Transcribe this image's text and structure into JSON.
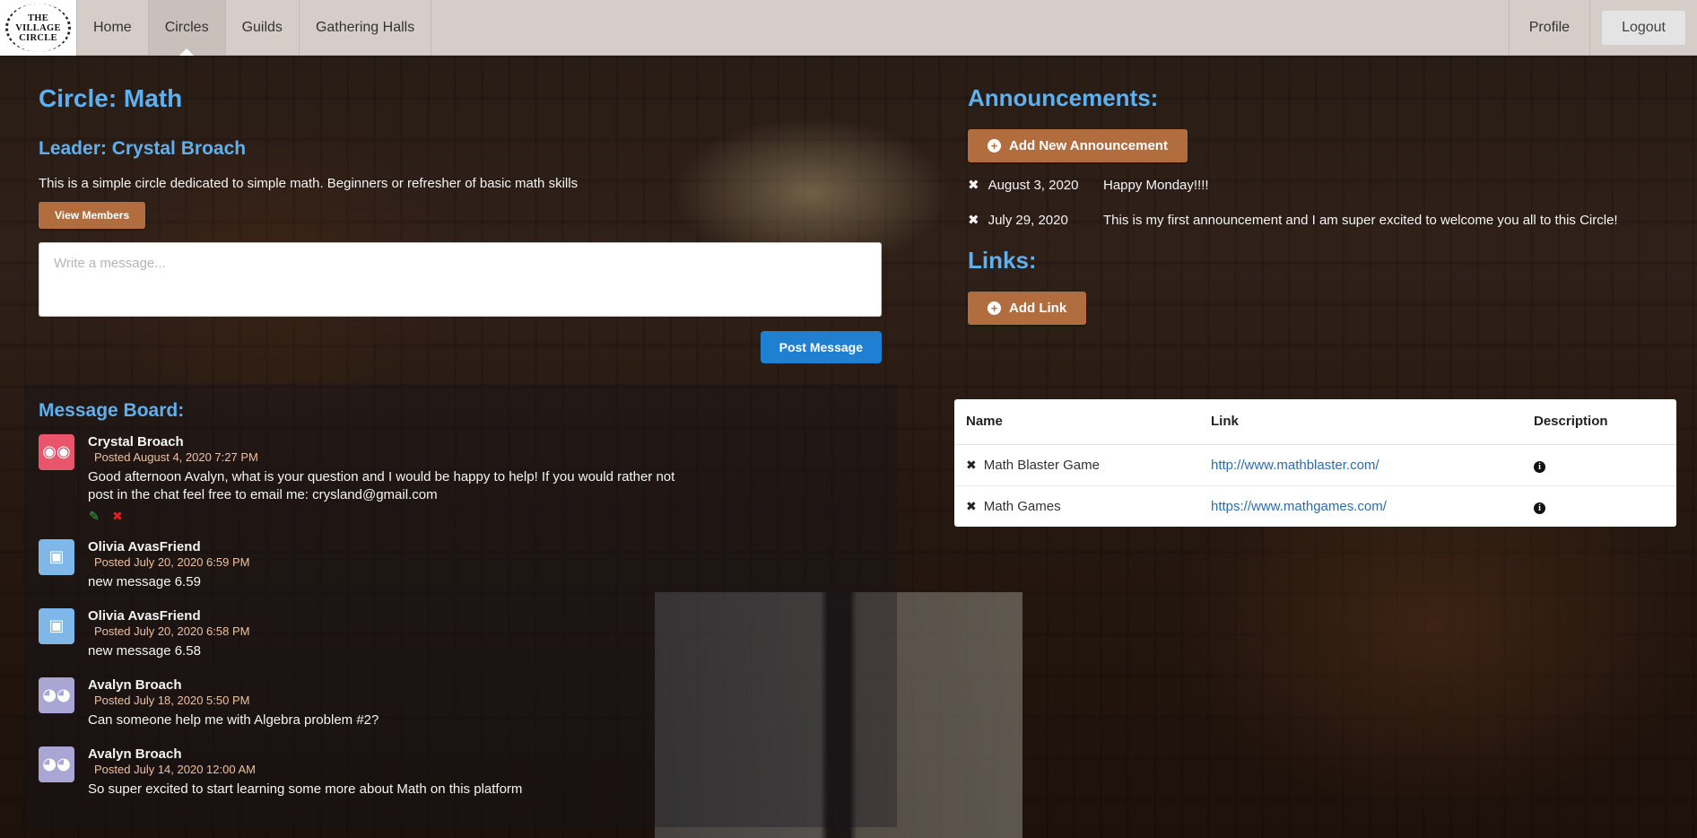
{
  "nav": {
    "logo_text": [
      "THE",
      "VILLAGE",
      "CIRCLE"
    ],
    "items": [
      {
        "label": "Home"
      },
      {
        "label": "Circles"
      },
      {
        "label": "Guilds"
      },
      {
        "label": "Gathering Halls"
      }
    ],
    "profile_label": "Profile",
    "logout_label": "Logout"
  },
  "circle": {
    "title": "Circle: Math",
    "leader": "Leader: Crystal Broach",
    "description": "This is a simple circle dedicated to simple math. Beginners or refresher of basic math skills",
    "view_members_label": "View Members",
    "message_placeholder": "Write a message...",
    "post_label": "Post Message"
  },
  "board": {
    "title": "Message Board:",
    "messages": [
      {
        "author": "Crystal Broach",
        "date": "Posted August 4, 2020 7:27 PM",
        "text": "Good afternoon Avalyn, what is your question and I would be happy to help! If you would rather not post in the chat feel free to email me: crysland@gmail.com",
        "avatar_color": "#e8556d"
      },
      {
        "author": "Olivia AvasFriend",
        "date": "Posted July 20, 2020 6:59 PM",
        "text": "new message 6.59",
        "avatar_color": "#7fb8e8"
      },
      {
        "author": "Olivia AvasFriend",
        "date": "Posted July 20, 2020 6:58 PM",
        "text": "new message 6.58",
        "avatar_color": "#7fb8e8"
      },
      {
        "author": "Avalyn Broach",
        "date": "Posted July 18, 2020 5:50 PM",
        "text": "Can someone help me with Algebra problem #2?",
        "avatar_color": "#a9a6d6"
      },
      {
        "author": "Avalyn Broach",
        "date": "Posted July 14, 2020 12:00 AM",
        "text": "So super excited to start learning some more about Math on this platform",
        "avatar_color": "#a9a6d6"
      }
    ]
  },
  "announcements": {
    "title": "Announcements:",
    "add_label": "Add New Announcement",
    "items": [
      {
        "date": "August 3, 2020",
        "text": "Happy Monday!!!!"
      },
      {
        "date": "July 29, 2020",
        "text": "This is my first announcement and I am super excited to welcome you all to this Circle!"
      }
    ]
  },
  "links": {
    "title": "Links:",
    "add_label": "Add Link",
    "headers": {
      "name": "Name",
      "link": "Link",
      "description": "Description"
    },
    "rows": [
      {
        "name": "Math Blaster Game",
        "url": "http://www.mathblaster.com/"
      },
      {
        "name": "Math Games",
        "url": "https://www.mathgames.com/"
      }
    ]
  },
  "colors": {
    "accent_blue": "#5fb0ef",
    "brown_button": "#b26d3f",
    "post_button": "#1f7fd1",
    "navbar": "#d6cdc9"
  },
  "icons": {
    "announcement_delete": "x-icon",
    "add": "plus-circle-icon",
    "info": "info-circle-icon",
    "message_edit": "edit-icon",
    "message_delete": "delete-icon"
  }
}
